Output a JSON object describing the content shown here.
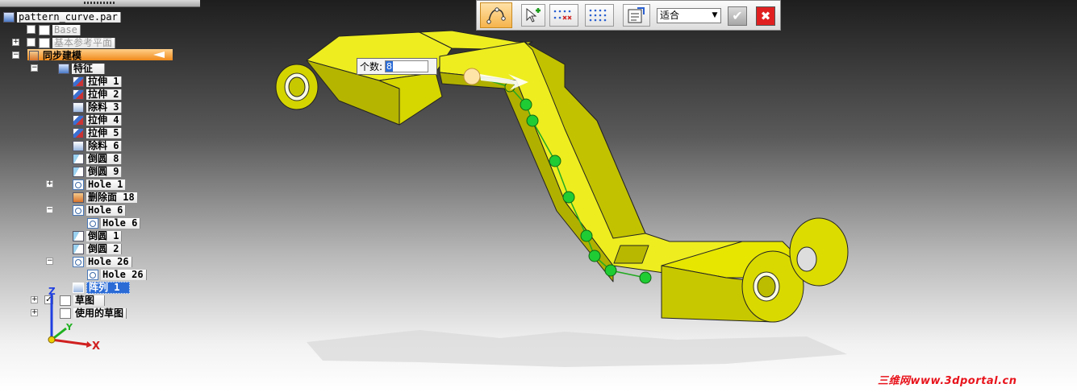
{
  "tree": {
    "root": "pattern_curve.par",
    "base": "Base",
    "ref_planes": "基本参考平面",
    "sync": "同步建模",
    "features": "特征",
    "items": [
      {
        "label": "拉伸 1",
        "icon": "extrude-icon"
      },
      {
        "label": "拉伸 2",
        "icon": "extrude-icon"
      },
      {
        "label": "除料 3",
        "icon": "cut-icon"
      },
      {
        "label": "拉伸 4",
        "icon": "extrude-icon"
      },
      {
        "label": "拉伸 5",
        "icon": "extrude-icon"
      },
      {
        "label": "除料 6",
        "icon": "cut-icon"
      },
      {
        "label": "倒圆 8",
        "icon": "round-icon"
      },
      {
        "label": "倒圆 9",
        "icon": "round-icon"
      },
      {
        "label": "Hole 1",
        "icon": "hole-icon"
      },
      {
        "label": "删除面 18",
        "icon": "delete-face-icon"
      },
      {
        "label": "Hole 6",
        "icon": "hole-icon"
      },
      {
        "label": "Hole 6",
        "icon": "hole-icon"
      },
      {
        "label": "倒圆 1",
        "icon": "round-icon"
      },
      {
        "label": "倒圆 2",
        "icon": "round-icon"
      },
      {
        "label": "Hole 26",
        "icon": "hole-icon"
      },
      {
        "label": "Hole 26",
        "icon": "hole-icon"
      },
      {
        "label": "阵列 1",
        "icon": "pattern-icon"
      }
    ],
    "sketches": "草图",
    "used_sketches": "使用的草图"
  },
  "command_bar": {
    "fit_option": "适合",
    "ok_icon": "check-icon",
    "cancel_icon": "close-icon"
  },
  "count": {
    "label": "个数:",
    "value": "8"
  },
  "triad": {
    "x": "X",
    "y": "Y",
    "z": "Z"
  },
  "watermark": "三维网www.3dportal.cn",
  "colors": {
    "part": "#e6e600",
    "selection": "#2a6bd6",
    "pattern_point": "#22cc22",
    "cancel": "#e02020"
  }
}
